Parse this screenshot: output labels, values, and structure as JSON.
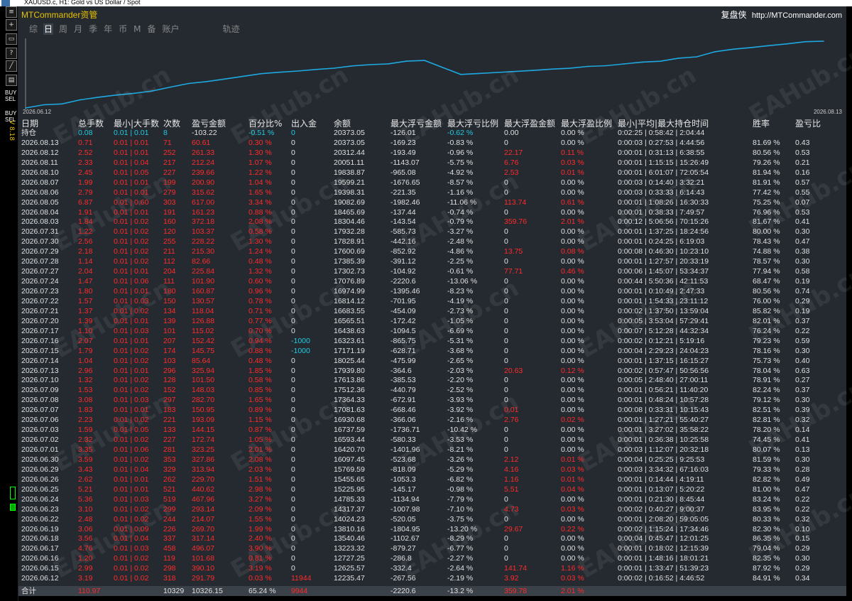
{
  "window": {
    "title": "XAUUSD.c, H1:  Gold vs US Dollar / Spot"
  },
  "left_toolbar": {
    "icons": [
      "list-icon",
      "crosshair-icon",
      "zoom-icon",
      "help-icon",
      "trend-icon",
      "text-icon",
      "chart-icon"
    ],
    "buy_label": "BUY",
    "sell_label": "SEL",
    "buy_label2": "BUY",
    "sell_label2": "SEL",
    "version": "V 8.18"
  },
  "header": {
    "brand": "MTCommander资管",
    "right_title": "复盘侠",
    "right_link": "http://MTCommander.com"
  },
  "tabs": [
    {
      "label": "综",
      "active": false
    },
    {
      "label": "日",
      "active": true
    },
    {
      "label": "周",
      "active": false
    },
    {
      "label": "月",
      "active": false
    },
    {
      "label": "季",
      "active": false
    },
    {
      "label": "年",
      "active": false
    },
    {
      "label": "币",
      "active": false
    },
    {
      "label": "M",
      "active": false
    },
    {
      "label": "备",
      "active": false
    },
    {
      "label": "账户",
      "active": false
    },
    {
      "label": "轨迹",
      "active": false
    }
  ],
  "watermark": "EAHub.cn",
  "chart_data": {
    "type": "line",
    "x_start_label": "2026.06.12",
    "x_end_label": "2026.08.13",
    "line_color": "#1ea8e0",
    "grid": false,
    "x": [
      "2026.06.12",
      "2026.06.15",
      "2026.06.16",
      "2026.06.17",
      "2026.06.18",
      "2026.06.19",
      "2026.06.22",
      "2026.06.23",
      "2026.06.24",
      "2026.06.25",
      "2026.06.26",
      "2026.06.29",
      "2026.06.30",
      "2026.07.01",
      "2026.07.02",
      "2026.07.03",
      "2026.07.06",
      "2026.07.07",
      "2026.07.08",
      "2026.07.09",
      "2026.07.10",
      "2026.07.13",
      "2026.07.14",
      "2026.07.15",
      "2026.07.16",
      "2026.07.17",
      "2026.07.20",
      "2026.07.21",
      "2026.07.22",
      "2026.07.23",
      "2026.07.24",
      "2026.07.27",
      "2026.07.28",
      "2026.07.29",
      "2026.07.30",
      "2026.07.31",
      "2026.08.03",
      "2026.08.04",
      "2026.08.05",
      "2026.08.06",
      "2026.08.07",
      "2026.08.10",
      "2026.08.11",
      "2026.08.12",
      "2026.08.13"
    ],
    "values": [
      12235.47,
      12625.57,
      12727.25,
      13223.32,
      13540.46,
      13810.16,
      14024.23,
      14317.37,
      14785.33,
      15225.95,
      15455.65,
      15769.59,
      16097.45,
      16420.7,
      16593.44,
      16737.59,
      16930.68,
      17081.63,
      17364.33,
      17512.36,
      17613.86,
      17939.8,
      18025.44,
      17171.19,
      16323.61,
      16438.63,
      16565.51,
      16683.55,
      16814.12,
      16974.99,
      17076.89,
      17302.73,
      17385.39,
      17600.69,
      17828.91,
      17932.28,
      18304.46,
      18465.69,
      19082.69,
      19398.31,
      19599.21,
      19838.87,
      20051.11,
      20312.44,
      20373.05
    ]
  },
  "table": {
    "headers": [
      "日期",
      "总手数",
      "最小|大手数",
      "次数",
      "盈亏金额",
      "百分比%",
      "出入金",
      "余额",
      "最大浮亏金额",
      "最大浮亏比例",
      "最大浮盈金额",
      "最大浮盈比例",
      "最小|平均|最大持仓时间",
      "胜率",
      "盈亏比"
    ],
    "holding": [
      "持仓",
      "0.08",
      "0.01 | 0.01",
      "8",
      "-103.22",
      "-0.51 %",
      "0",
      "20373.05",
      "-126.01",
      "-0.62 %",
      "0.00",
      "0.00 %",
      "0:02:25 | 0:58:42 | 2:04:44",
      "",
      ""
    ],
    "rows": [
      [
        "2026.08.13",
        "0.71",
        "0.01 | 0.01",
        "71",
        "60.61",
        "0.30 %",
        "0",
        "20373.05",
        "-169.23",
        "-0.83 %",
        "0",
        "0.00 %",
        "0:00:03 | 0:27:53 | 4:44:56",
        "81.69 %",
        "0.43"
      ],
      [
        "2026.08.12",
        "2.52",
        "0.01 | 0.01",
        "252",
        "261.33",
        "1.30 %",
        "0",
        "20312.44",
        "-193.49",
        "-0.96 %",
        "22.17",
        "0.11 %",
        "0:00:01 | 0:31:13 | 6:38:55",
        "80.56 %",
        "0.53"
      ],
      [
        "2026.08.11",
        "2.33",
        "0.01 | 0.04",
        "217",
        "212.24",
        "1.07 %",
        "0",
        "20051.11",
        "-1143.07",
        "-5.75 %",
        "6.76",
        "0.03 %",
        "0:00:01 | 1:15:15 | 15:26:49",
        "79.26 %",
        "0.21"
      ],
      [
        "2026.08.10",
        "2.45",
        "0.01 | 0.05",
        "227",
        "239.66",
        "1.22 %",
        "0",
        "19838.87",
        "-965.08",
        "-4.92 %",
        "2.53",
        "0.01 %",
        "0:00:01 | 6:01:07 | 72:05:54",
        "81.94 %",
        "0.16"
      ],
      [
        "2026.08.07",
        "1.99",
        "0.01 | 0.01",
        "199",
        "200.90",
        "1.04 %",
        "0",
        "19599.21",
        "-1676.65",
        "-8.57 %",
        "0",
        "0.00 %",
        "0:00:03 | 0:14:40 | 3:32:21",
        "81.91 %",
        "0.57"
      ],
      [
        "2026.08.06",
        "2.79",
        "0.01 | 0.01",
        "279",
        "315.62",
        "1.65 %",
        "0",
        "19398.31",
        "-221.35",
        "-1.16 %",
        "0",
        "0.00 %",
        "0:00:03 | 0:33:33 | 6:14:43",
        "77.42 %",
        "0.55"
      ],
      [
        "2026.08.05",
        "6.87",
        "0.01 | 0.60",
        "303",
        "617.00",
        "3.34 %",
        "0",
        "19082.69",
        "-1982.46",
        "-11.06 %",
        "113.74",
        "0.61 %",
        "0:00:01 | 1:08:26 | 16:30:33",
        "75.25 %",
        "0.07"
      ],
      [
        "2026.08.04",
        "1.91",
        "0.01 | 0.01",
        "191",
        "161.23",
        "0.88 %",
        "0",
        "18465.69",
        "-137.44",
        "-0.74 %",
        "0",
        "0.00 %",
        "0:00:01 | 0:38:33 | 7:49:57",
        "76.96 %",
        "0.53"
      ],
      [
        "2026.08.03",
        "1.84",
        "0.01 | 0.02",
        "160",
        "372.18",
        "2.08 %",
        "0",
        "18304.46",
        "-143.54",
        "-0.79 %",
        "359.76",
        "2.01 %",
        "0:00:12 | 5:06:56 | 70:15:26",
        "81.67 %",
        "0.41"
      ],
      [
        "2026.07.31",
        "1.22",
        "0.01 | 0.02",
        "120",
        "103.37",
        "0.58 %",
        "0",
        "17932.28",
        "-585.73",
        "-3.27 %",
        "0",
        "0.00 %",
        "0:00:01 | 1:37:25 | 18:24:56",
        "80.00 %",
        "0.30"
      ],
      [
        "2026.07.30",
        "2.56",
        "0.01 | 0.02",
        "255",
        "228.22",
        "1.30 %",
        "0",
        "17828.91",
        "-442.16",
        "-2.48 %",
        "0",
        "0.00 %",
        "0:00:01 | 0:24:25 | 6:19:03",
        "78.43 %",
        "0.47"
      ],
      [
        "2026.07.29",
        "2.18",
        "0.01 | 0.02",
        "211",
        "215.30",
        "1.24 %",
        "0",
        "17600.69",
        "-852.92",
        "-4.86 %",
        "13.75",
        "0.08 %",
        "0:00:08 | 0:46:30 | 10:23:10",
        "74.88 %",
        "0.38"
      ],
      [
        "2026.07.28",
        "1.14",
        "0.01 | 0.02",
        "112",
        "82.66",
        "0.48 %",
        "0",
        "17385.39",
        "-391.12",
        "-2.25 %",
        "0",
        "0.00 %",
        "0:00:01 | 1:27:57 | 20:33:19",
        "78.57 %",
        "0.30"
      ],
      [
        "2026.07.27",
        "2.04",
        "0.01 | 0.01",
        "204",
        "225.84",
        "1.32 %",
        "0",
        "17302.73",
        "-104.92",
        "-0.61 %",
        "77.71",
        "0.46 %",
        "0:00:06 | 1:45:07 | 53:34:37",
        "77.94 %",
        "0.58"
      ],
      [
        "2026.07.24",
        "1.47",
        "0.01 | 0.06",
        "111",
        "101.90",
        "0.60 %",
        "0",
        "17076.89",
        "-2220.6",
        "-13.06 %",
        "0",
        "0.00 %",
        "0:00:44 | 5:50:36 | 42:11:53",
        "68.47 %",
        "0.19"
      ],
      [
        "2026.07.23",
        "1.80",
        "0.01 | 0.01",
        "180",
        "160.87",
        "0.96 %",
        "0",
        "16974.99",
        "-1395.46",
        "-8.23 %",
        "0",
        "0.00 %",
        "0:00:01 | 0:10:49 | 2:47:33",
        "80.56 %",
        "0.74"
      ],
      [
        "2026.07.22",
        "1.57",
        "0.01 | 0.03",
        "150",
        "130.57",
        "0.78 %",
        "0",
        "16814.12",
        "-701.95",
        "-4.19 %",
        "0",
        "0.00 %",
        "0:00:01 | 1:54:33 | 23:11:12",
        "76.00 %",
        "0.29"
      ],
      [
        "2026.07.21",
        "1.37",
        "0.01 | 0.02",
        "134",
        "118.04",
        "0.71 %",
        "0",
        "16683.55",
        "-454.09",
        "-2.73 %",
        "0",
        "0.00 %",
        "0:00:02 | 1:37:50 | 13:59:04",
        "85.82 %",
        "0.19"
      ],
      [
        "2026.07.20",
        "1.39",
        "0.01 | 0.01",
        "139",
        "126.88",
        "0.77 %",
        "0",
        "16565.51",
        "-172.42",
        "-1.05 %",
        "0",
        "0.00 %",
        "0:00:05 | 3:53:04 | 57:29:41",
        "82.01 %",
        "0.37"
      ],
      [
        "2026.07.17",
        "1.10",
        "0.01 | 0.03",
        "101",
        "115.02",
        "0.70 %",
        "0",
        "16438.63",
        "-1094.5",
        "-6.69 %",
        "0",
        "0.00 %",
        "0:00:07 | 5:12:28 | 44:32:34",
        "76.24 %",
        "0.22"
      ],
      [
        "2026.07.16",
        "2.07",
        "0.01 | 0.01",
        "207",
        "152.42",
        "0.94 %",
        "-1000",
        "16323.61",
        "-865.75",
        "-5.31 %",
        "0",
        "0.00 %",
        "0:00:02 | 0:12:21 | 5:19:16",
        "79.23 %",
        "0.59"
      ],
      [
        "2026.07.15",
        "1.79",
        "0.01 | 0.02",
        "174",
        "145.75",
        "0.88 %",
        "-1000",
        "17171.19",
        "-628.71",
        "-3.68 %",
        "0",
        "0.00 %",
        "0:00:04 | 2:29:23 | 24:04:23",
        "78.16 %",
        "0.30"
      ],
      [
        "2026.07.14",
        "1.04",
        "0.01 | 0.02",
        "103",
        "85.64",
        "0.48 %",
        "0",
        "18025.44",
        "-475.99",
        "-2.65 %",
        "0",
        "0.00 %",
        "0:00:01 | 1:37:15 | 16:15:27",
        "75.73 %",
        "0.40"
      ],
      [
        "2026.07.13",
        "2.96",
        "0.01 | 0.01",
        "296",
        "325.94",
        "1.85 %",
        "0",
        "17939.80",
        "-364.6",
        "-2.03 %",
        "20.63",
        "0.12 %",
        "0:00:02 | 0:57:47 | 50:56:56",
        "78.04 %",
        "0.63"
      ],
      [
        "2026.07.10",
        "1.32",
        "0.01 | 0.02",
        "128",
        "101.50",
        "0.58 %",
        "0",
        "17613.86",
        "-385.53",
        "-2.20 %",
        "0",
        "0.00 %",
        "0:00:05 | 2:48:40 | 27:00:11",
        "78.91 %",
        "0.27"
      ],
      [
        "2026.07.09",
        "1.53",
        "0.01 | 0.02",
        "152",
        "148.03",
        "0.85 %",
        "0",
        "17512.36",
        "-440.79",
        "-2.52 %",
        "0",
        "0.00 %",
        "0:00:01 | 0:56:21 | 11:40:20",
        "82.24 %",
        "0.37"
      ],
      [
        "2026.07.08",
        "3.08",
        "0.01 | 0.03",
        "297",
        "282.70",
        "1.65 %",
        "0",
        "17364.33",
        "-672.91",
        "-3.93 %",
        "0",
        "0.00 %",
        "0:00:01 | 0:48:24 | 10:57:28",
        "79.12 %",
        "0.30"
      ],
      [
        "2026.07.07",
        "1.83",
        "0.01 | 0.01",
        "183",
        "150.95",
        "0.89 %",
        "0",
        "17081.63",
        "-668.46",
        "-3.92 %",
        "0.01",
        "0.00 %",
        "0:00:08 | 0:33:31 | 10:15:43",
        "82.51 %",
        "0.39"
      ],
      [
        "2026.07.06",
        "2.23",
        "0.01 | 0.02",
        "221",
        "193.09",
        "1.15 %",
        "0",
        "16930.68",
        "-366.06",
        "-2.16 %",
        "2.76",
        "0.02 %",
        "0:00:01 | 1:27:21 | 55:40:27",
        "82.81 %",
        "0.32"
      ],
      [
        "2026.07.03",
        "1.59",
        "0.01 | 0.05",
        "133",
        "144.15",
        "0.87 %",
        "0",
        "16737.59",
        "-1736.71",
        "-10.42 %",
        "0",
        "0.00 %",
        "0:00:01 | 3:27:02 | 35:58:22",
        "78.20 %",
        "0.14"
      ],
      [
        "2026.07.02",
        "2.32",
        "0.01 | 0.02",
        "227",
        "172.74",
        "1.05 %",
        "0",
        "16593.44",
        "-580.33",
        "-3.53 %",
        "0",
        "0.00 %",
        "0:00:01 | 0:36:38 | 10:25:58",
        "74.45 %",
        "0.41"
      ],
      [
        "2026.07.01",
        "3.35",
        "0.01 | 0.06",
        "281",
        "323.25",
        "2.01 %",
        "0",
        "16420.70",
        "-1401.96",
        "-8.21 %",
        "0",
        "0.00 %",
        "0:00:03 | 1:12:07 | 20:32:18",
        "80.07 %",
        "0.13"
      ],
      [
        "2026.06.30",
        "3.59",
        "0.01 | 0.02",
        "353",
        "327.86",
        "2.08 %",
        "0",
        "16097.45",
        "-523.68",
        "-3.26 %",
        "2.12",
        "0.01 %",
        "0:00:04 | 0:25:25 | 9:25:53",
        "81.59 %",
        "0.30"
      ],
      [
        "2026.06.29",
        "3.43",
        "0.01 | 0.04",
        "329",
        "313.94",
        "2.03 %",
        "0",
        "15769.59",
        "-818.09",
        "-5.29 %",
        "4.16",
        "0.03 %",
        "0:00:03 | 3:34:32 | 67:16:03",
        "79.33 %",
        "0.28"
      ],
      [
        "2026.06.26",
        "2.62",
        "0.01 | 0.01",
        "262",
        "229.70",
        "1.51 %",
        "0",
        "15455.65",
        "-1053.3",
        "-6.82 %",
        "1.16",
        "0.01 %",
        "0:00:01 | 0:14:44 | 4:19:11",
        "82.82 %",
        "0.49"
      ],
      [
        "2026.06.25",
        "5.21",
        "0.01 | 0.01",
        "521",
        "440.62",
        "2.98 %",
        "0",
        "15225.95",
        "-145.17",
        "-0.98 %",
        "5.51",
        "0.04 %",
        "0:00:01 | 0:13:07 | 5:20:22",
        "81.00 %",
        "0.47"
      ],
      [
        "2026.06.24",
        "5.36",
        "0.01 | 0.03",
        "519",
        "467.96",
        "3.27 %",
        "0",
        "14785.33",
        "-1134.94",
        "-7.79 %",
        "0",
        "0.00 %",
        "0:00:01 | 0:21:30 | 8:45:44",
        "83.24 %",
        "0.22"
      ],
      [
        "2026.06.23",
        "3.10",
        "0.01 | 0.02",
        "299",
        "293.14",
        "2.09 %",
        "0",
        "14317.37",
        "-1007.98",
        "-7.10 %",
        "4.73",
        "0.03 %",
        "0:00:02 | 0:40:27 | 9:00:37",
        "83.95 %",
        "0.22"
      ],
      [
        "2026.06.22",
        "2.48",
        "0.01 | 0.02",
        "244",
        "214.07",
        "1.55 %",
        "0",
        "14024.23",
        "-520.05",
        "-3.75 %",
        "0",
        "0.00 %",
        "0:00:01 | 2:08:20 | 59:05:05",
        "80.33 %",
        "0.32"
      ],
      [
        "2026.06.19",
        "3.06",
        "0.01 | 0.09",
        "226",
        "269.70",
        "1.99 %",
        "0",
        "13810.16",
        "-1804.95",
        "-13.20 %",
        "29.67",
        "0.22 %",
        "0:00:02 | 1:15:24 | 17:34:46",
        "82.30 %",
        "0.10"
      ],
      [
        "2026.06.18",
        "3.56",
        "0.01 | 0.04",
        "337",
        "317.14",
        "2.40 %",
        "0",
        "13540.46",
        "-1102.67",
        "-8.29 %",
        "0",
        "0.00 %",
        "0:00:04 | 0:45:47 | 12:01:25",
        "86.35 %",
        "0.15"
      ],
      [
        "2026.06.17",
        "4.76",
        "0.01 | 0.03",
        "458",
        "496.07",
        "3.90 %",
        "0",
        "13223.32",
        "-879.27",
        "-6.77 %",
        "0",
        "0.00 %",
        "0:00:01 | 0:18:02 | 12:15:39",
        "79.04 %",
        "0.29"
      ],
      [
        "2026.06.16",
        "1.20",
        "0.01 | 0.02",
        "119",
        "101.68",
        "0.81 %",
        "0",
        "12727.25",
        "-286.8",
        "-2.27 %",
        "0",
        "0.00 %",
        "0:00:01 | 1:48:16 | 18:01:21",
        "82.35 %",
        "0.30"
      ],
      [
        "2026.06.15",
        "2.99",
        "0.01 | 0.02",
        "298",
        "390.10",
        "3.19 %",
        "0",
        "12625.57",
        "-332.4",
        "-2.64 %",
        "141.74",
        "1.16 %",
        "0:00:01 | 1:33:47 | 51:39:23",
        "87.92 %",
        "0.29"
      ],
      [
        "2026.06.12",
        "3.19",
        "0.01 | 0.02",
        "318",
        "291.79",
        "0.03 %",
        "11944",
        "12235.47",
        "-267.56",
        "-2.19 %",
        "3.92",
        "0.03 %",
        "0:00:02 | 0:16:52 | 4:46:52",
        "84.91 %",
        "0.34"
      ]
    ],
    "total": [
      "合计",
      "110.97",
      "",
      "10329",
      "10326.15",
      "65.24 %",
      "9944",
      "",
      "-2220.6",
      "-13.2 %",
      "359.78",
      "2.01 %",
      "",
      "",
      ""
    ]
  }
}
